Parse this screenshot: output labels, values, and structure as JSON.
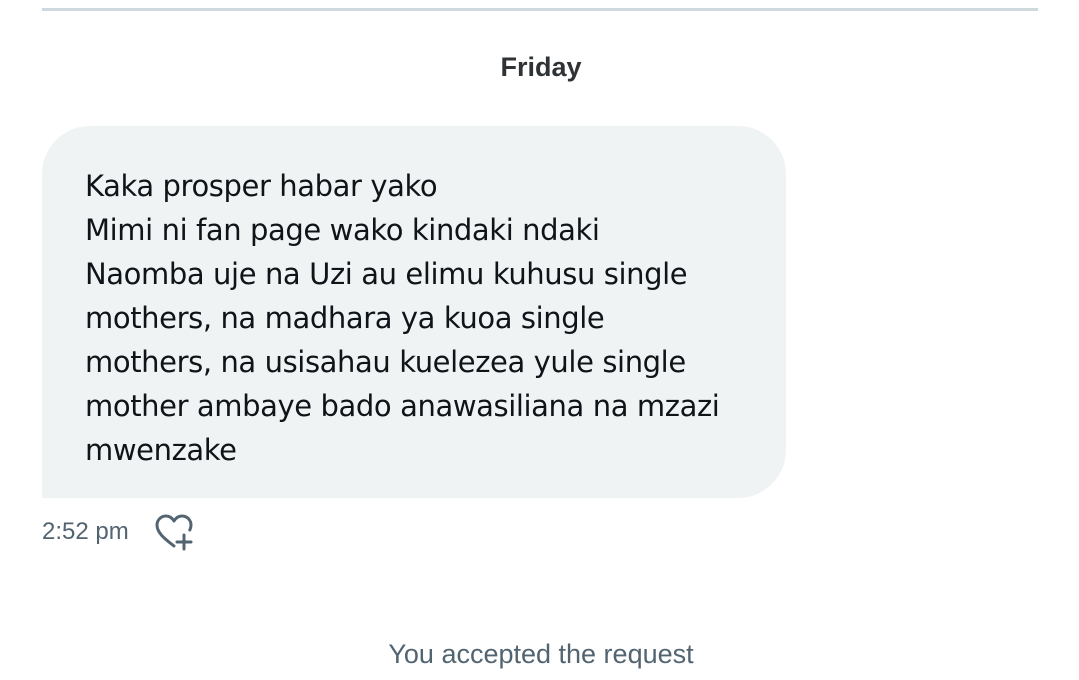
{
  "conversation": {
    "day_separator": "Friday",
    "message": {
      "lines": [
        "Kaka prosper habar yako",
        "Mimi ni fan page wako kindaki ndaki",
        "Naomba uje na Uzi au elimu kuhusu single",
        "mothers, na madhara ya kuoa single",
        "mothers, na usisahau kuelezea yule single",
        "mother ambaye bado anawasiliana na mzazi",
        "mwenzake"
      ],
      "timestamp": "2:52 pm",
      "react_icon": "heart-plus-icon"
    },
    "system_notice": "You accepted the request"
  },
  "colors": {
    "bubble_background": "#eff3f4",
    "message_text": "#0f1419",
    "secondary_text": "#536471",
    "divider": "#cfd9de"
  }
}
